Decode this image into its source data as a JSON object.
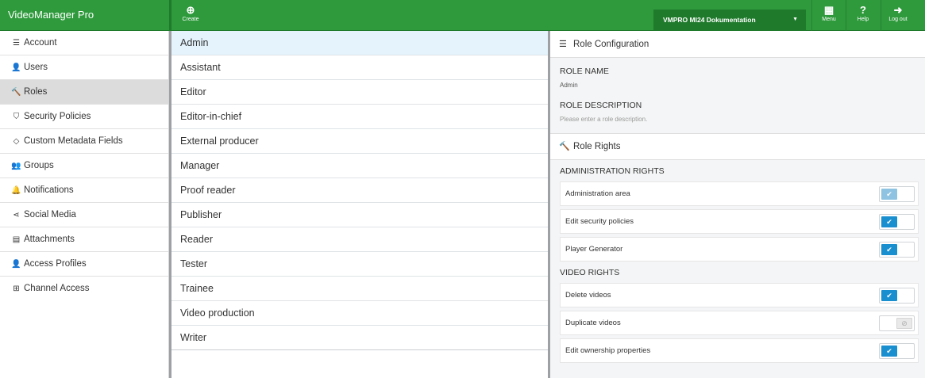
{
  "app": {
    "title": "VideoManager Pro"
  },
  "topbar": {
    "create_label": "Create",
    "workspace": "VMPRO MI24 Dokumentation",
    "menu_label": "Menu",
    "help_label": "Help",
    "logout_label": "Log out"
  },
  "nav": {
    "items": [
      {
        "label": "Account",
        "icon": "account-icon"
      },
      {
        "label": "Users",
        "icon": "user-icon"
      },
      {
        "label": "Roles",
        "icon": "gavel-icon"
      },
      {
        "label": "Security Policies",
        "icon": "shield-icon"
      },
      {
        "label": "Custom Metadata Fields",
        "icon": "tag-icon"
      },
      {
        "label": "Groups",
        "icon": "group-icon"
      },
      {
        "label": "Notifications",
        "icon": "bell-icon"
      },
      {
        "label": "Social Media",
        "icon": "share-icon"
      },
      {
        "label": "Attachments",
        "icon": "file-icon"
      },
      {
        "label": "Access Profiles",
        "icon": "access-profile-icon"
      },
      {
        "label": "Channel Access",
        "icon": "channel-icon"
      }
    ],
    "active": "Roles"
  },
  "roles": {
    "items": [
      "Admin",
      "Assistant",
      "Editor",
      "Editor-in-chief",
      "External producer",
      "Manager",
      "Proof reader",
      "Publisher",
      "Reader",
      "Tester",
      "Trainee",
      "Video production",
      "Writer"
    ],
    "selected": "Admin"
  },
  "config": {
    "header": "Role Configuration",
    "role_name_label": "ROLE NAME",
    "role_name_value": "Admin",
    "role_desc_label": "ROLE DESCRIPTION",
    "role_desc_placeholder": "Please enter a role description.",
    "rights_header": "Role Rights",
    "admin_rights_label": "ADMINISTRATION RIGHTS",
    "admin_rights": [
      {
        "label": "Administration area",
        "state": "on-light"
      },
      {
        "label": "Edit security policies",
        "state": "on"
      },
      {
        "label": "Player Generator",
        "state": "on"
      }
    ],
    "video_rights_label": "VIDEO RIGHTS",
    "video_rights": [
      {
        "label": "Delete videos",
        "state": "on"
      },
      {
        "label": "Duplicate videos",
        "state": "off"
      },
      {
        "label": "Edit ownership properties",
        "state": "on"
      }
    ]
  }
}
